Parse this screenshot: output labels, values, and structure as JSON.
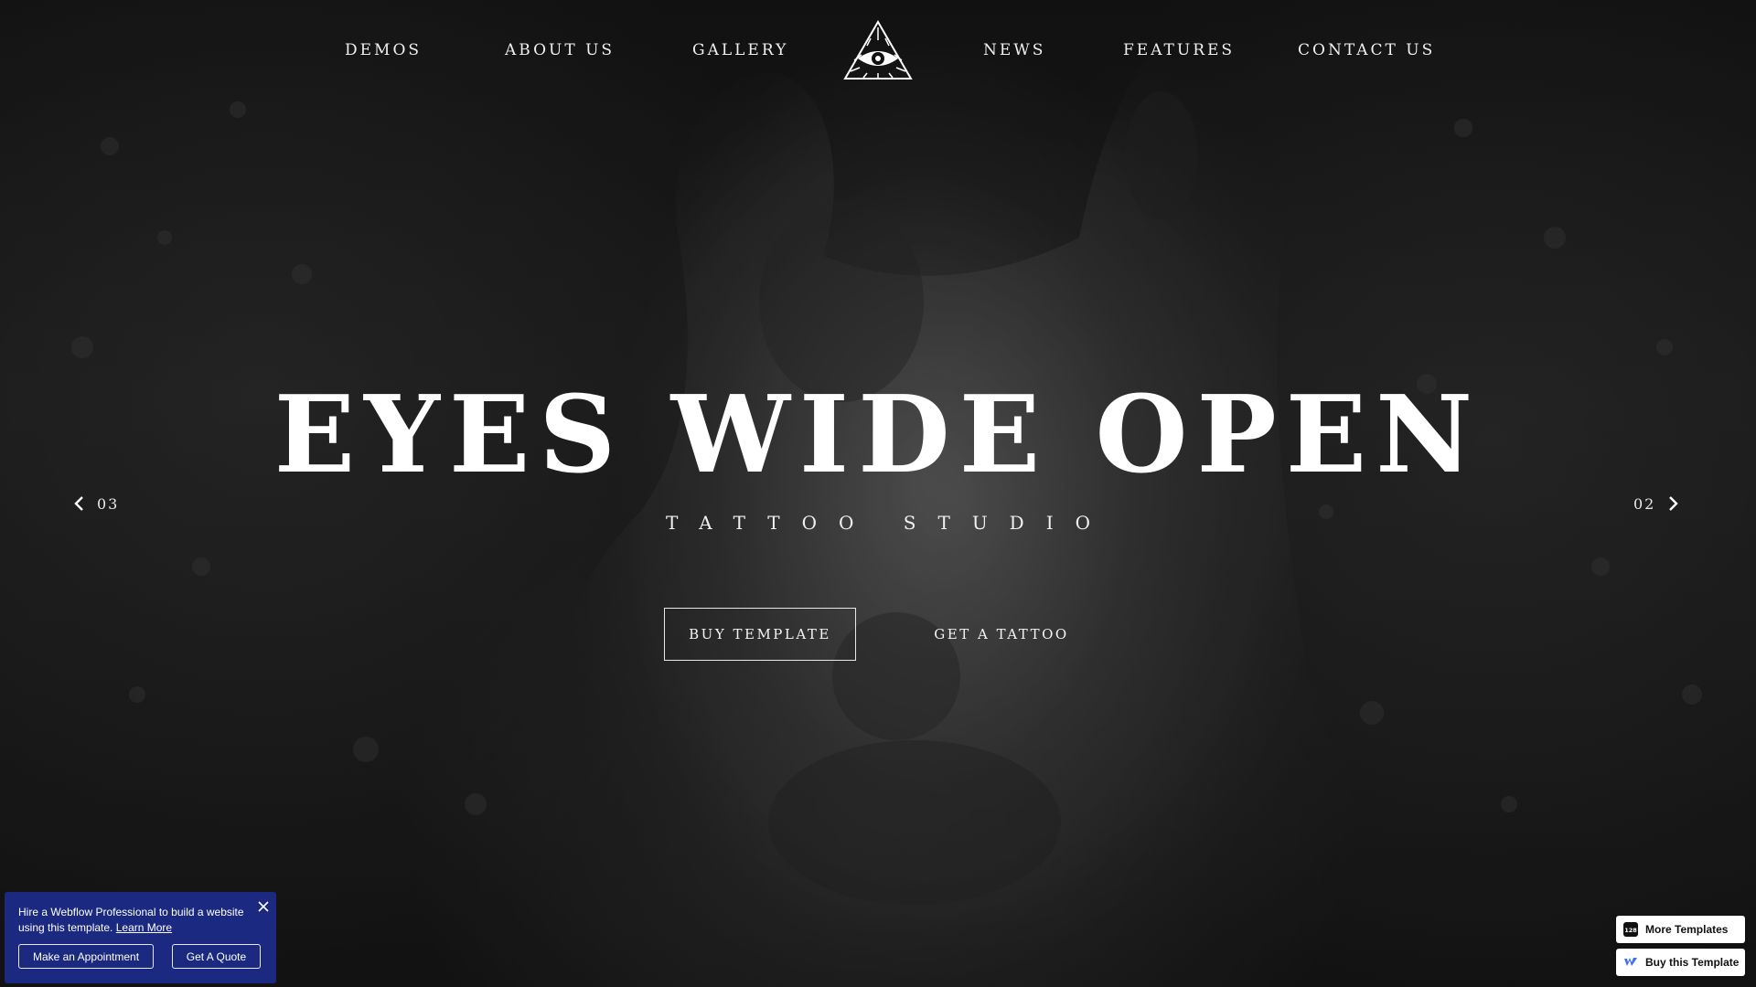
{
  "nav": {
    "items": [
      {
        "label": "DEMOS"
      },
      {
        "label": "ABOUT US"
      },
      {
        "label": "GALLERY"
      },
      {
        "label": "NEWS"
      },
      {
        "label": "FEATURES"
      },
      {
        "label": "CONTACT US"
      }
    ],
    "logo_icon": "all-seeing-eye-icon"
  },
  "hero": {
    "title": "EYES WIDE OPEN",
    "subtitle": "TATTOO STUDIO",
    "primary_button": "BUY TEMPLATE",
    "secondary_button": "GET A TATTOO"
  },
  "slider": {
    "prev_number": "03",
    "next_number": "02",
    "prev_icon": "chevron-left-icon",
    "next_icon": "chevron-right-icon"
  },
  "promo": {
    "text": "Hire a Webflow Professional to build a website using this template.",
    "link": "Learn More",
    "button_1": "Make an Appointment",
    "button_2": "Get A Quote",
    "close_icon": "close-icon",
    "background": "#1b2a80"
  },
  "badges": {
    "more_templates": "More Templates",
    "more_templates_icon_text": "128",
    "buy_template": "Buy this Template",
    "buy_icon": "webflow-icon"
  }
}
